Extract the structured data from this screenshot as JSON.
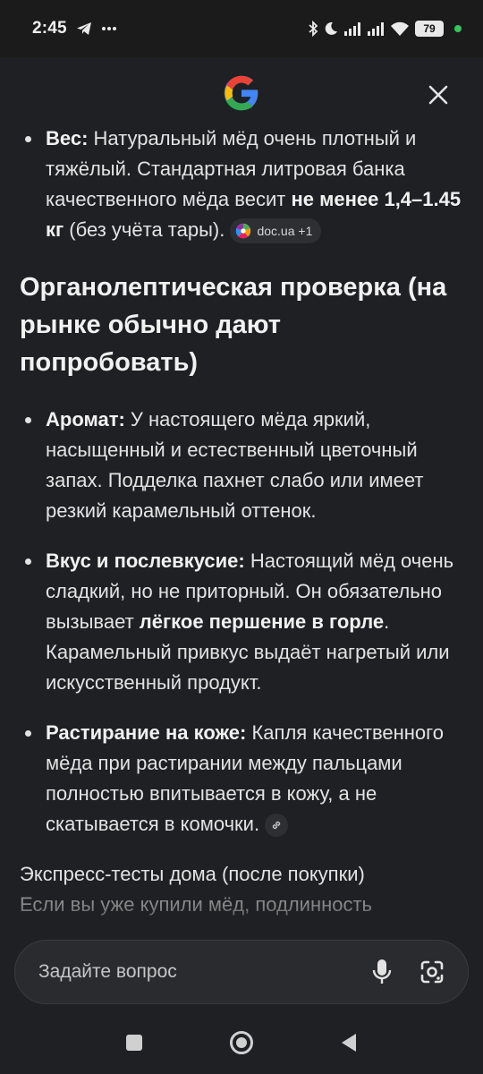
{
  "status_bar": {
    "time": "2:45",
    "battery": "79",
    "icons": [
      "telegram-icon",
      "more-dots-icon",
      "bluetooth-icon",
      "do-not-disturb-icon",
      "signal-icon",
      "signal-icon",
      "wifi-icon",
      "battery-icon"
    ]
  },
  "header": {
    "logo": "google-g-logo",
    "close_icon": "close-icon"
  },
  "content": {
    "weight_bullet": {
      "label": "Вес:",
      "text1": " Натуральный мёд очень плотный и тяжёлый. Стандартная литровая банка качественного мёда весит ",
      "bold": "не менее 1,4–1.45 кг",
      "text2": " (без учёта тары). ",
      "source_chip": "doc.ua +1"
    },
    "section_heading": "Органолептическая проверка (на рынке обычно дают попробовать)",
    "aroma_bullet": {
      "label": "Аромат:",
      "text": " У настоящего мёда яркий, насыщенный и естественный цветочный запах. Подделка пахнет слабо или имеет резкий карамельный оттенок."
    },
    "taste_bullet": {
      "label": "Вкус и послевкусие:",
      "text1": " Настоящий мёд очень сладкий, но не приторный. Он обязательно вызывает ",
      "bold": "лёгкое першение в горле",
      "text2": ". Карамельный привкус выдаёт нагретый или искусственный продукт."
    },
    "skin_bullet": {
      "label": "Растирание на коже:",
      "text": " Капля качественного мёда при растирании между пальцами полностью впитывается в кожу, а не скатывается в комочки. "
    },
    "express_heading": "Экспресс-тесты дома (после покупки)",
    "faded_text": "Если вы уже купили мёд, подлинность"
  },
  "input": {
    "placeholder": "Задайте вопрос"
  },
  "colors": {
    "background": "#1f2023",
    "text": "#e3e3e3",
    "chip": "#2d2f33"
  }
}
